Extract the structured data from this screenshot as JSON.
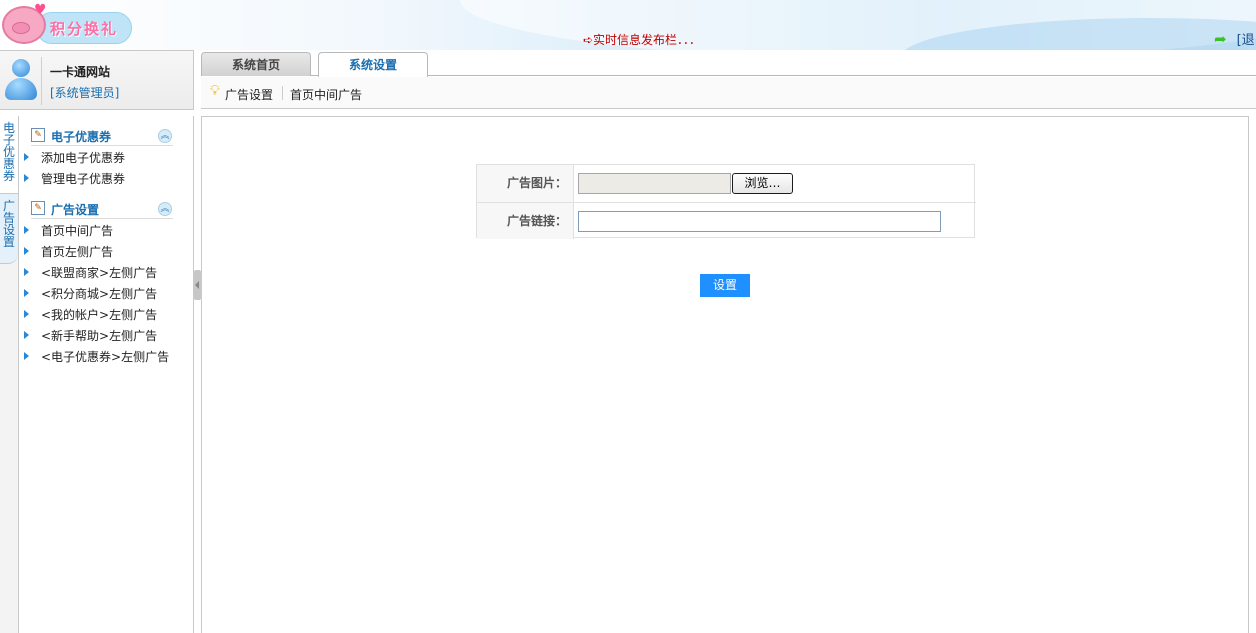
{
  "header": {
    "logo_text": "积分换礼",
    "ticker": "➪实时信息发布栏．．．",
    "exit_label": "[退"
  },
  "user": {
    "site_name": "一卡通网站",
    "role": "[系统管理员]"
  },
  "tabs": [
    {
      "label": "系统首页",
      "active": false
    },
    {
      "label": "系统设置",
      "active": true
    }
  ],
  "breadcrumb": [
    "广告设置",
    "首页中间广告"
  ],
  "vertical_tabs": [
    "电子优惠券",
    "广告设置"
  ],
  "menu": {
    "groups": [
      {
        "title": "电子优惠券",
        "items": [
          "添加电子优惠券",
          "管理电子优惠券"
        ]
      },
      {
        "title": "广告设置",
        "items": [
          "首页中间广告",
          "首页左侧广告",
          "<联盟商家>左侧广告",
          "<积分商城>左侧广告",
          "<我的帐户>左侧广告",
          "<新手帮助>左侧广告",
          "<电子优惠券>左侧广告"
        ]
      }
    ]
  },
  "form": {
    "image_label": "广告图片：",
    "image_value": "",
    "browse_label": "浏览…",
    "link_label": "广告链接：",
    "link_value": "",
    "submit_label": "设置"
  },
  "colors": {
    "accent_blue": "#1a6fb0",
    "submit_bg": "#1e90ff",
    "ticker_red": "#c00000"
  }
}
